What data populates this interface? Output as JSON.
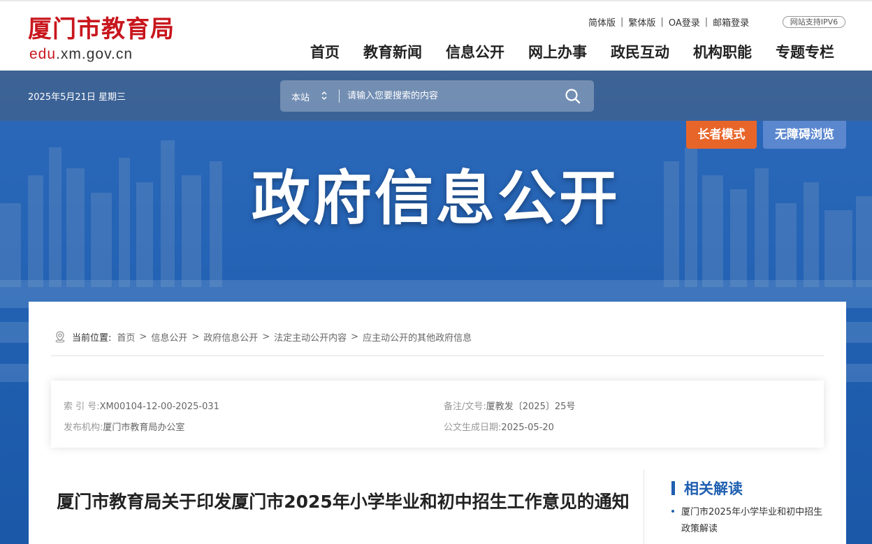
{
  "header": {
    "logo_cn": "厦门市教育局",
    "logo_en_red": "edu",
    "logo_en_rest": ".xm.gov.cn",
    "toplinks": [
      "简体版",
      "繁体版",
      "OA登录",
      "邮箱登录"
    ],
    "ipv6": "网站支持IPV6",
    "nav": [
      "首页",
      "教育新闻",
      "信息公开",
      "网上办事",
      "政民互动",
      "机构职能",
      "专题专栏"
    ]
  },
  "banner": {
    "date": "2025年5月21日 星期三",
    "search_scope": "本站",
    "search_placeholder": "请输入您要搜索的内容",
    "elder_mode": "长者模式",
    "accessibility": "无障碍浏览",
    "title": "政府信息公开"
  },
  "breadcrumb": {
    "label": "当前位置:",
    "items": [
      "首页",
      "信息公开",
      "政府信息公开",
      "法定主动公开内容",
      "应主动公开的其他政府信息"
    ]
  },
  "meta": {
    "index_label": "索 引 号:",
    "index_value": "XM00104-12-00-2025-031",
    "docno_label": "备注/文号:",
    "docno_value": "厦教发〔2025〕25号",
    "publisher_label": "发布机构:",
    "publisher_value": "厦门市教育局办公室",
    "date_label": "公文生成日期:",
    "date_value": "2025-05-20"
  },
  "article": {
    "title": "厦门市教育局关于印发厦门市2025年小学毕业和初中招生工作意见的通知"
  },
  "sidebar": {
    "title": "相关解读",
    "items": [
      "厦门市2025年小学毕业和初中招生政策解读"
    ]
  },
  "colors": {
    "brand_red": "#c8161d",
    "brand_blue": "#1f5fb0",
    "elder_orange": "#e8652a",
    "access_blue": "#5b87cf"
  }
}
